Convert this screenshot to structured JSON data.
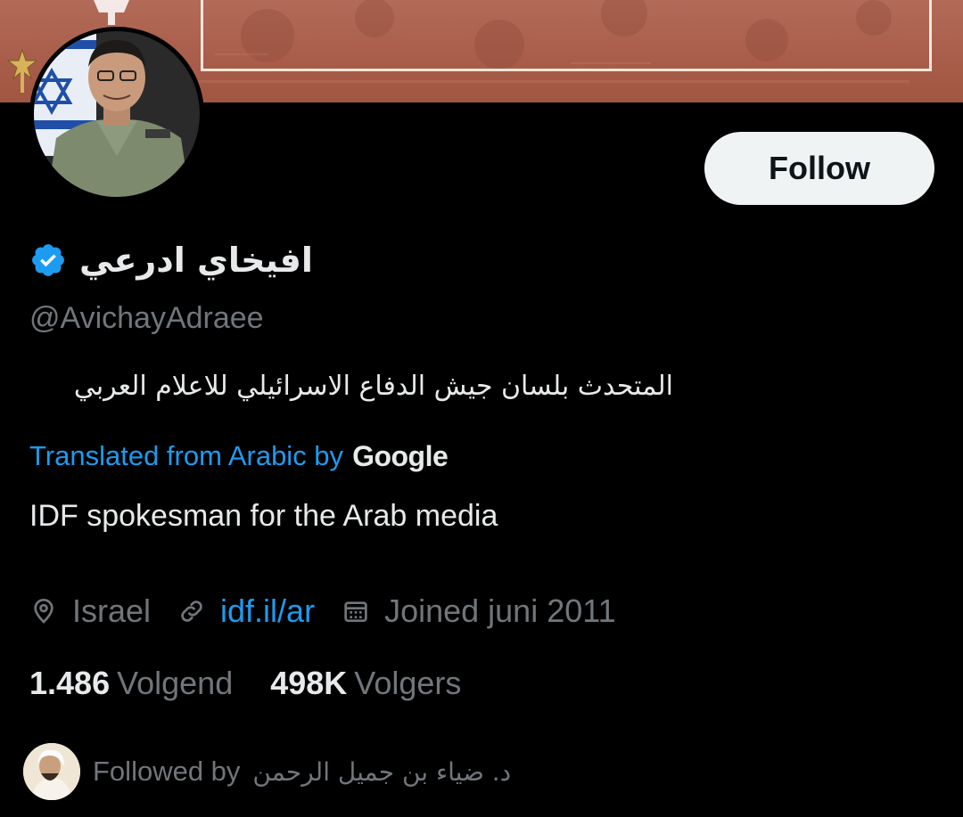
{
  "profile": {
    "display_name": "افيخاي ادرعي",
    "handle": "@AvichayAdraee",
    "bio_original": "المتحدث بلسان جيش الدفاع الاسرائيلي للاعلام العربي",
    "translated_label": "Translated from Arabic by",
    "translator_brand": "Google",
    "bio_translated": "IDF spokesman for the Arab media",
    "location": "Israel",
    "website": "idf.il/ar",
    "joined": "Joined juni 2011",
    "verified": true
  },
  "actions": {
    "follow_label": "Follow"
  },
  "stats": {
    "following_count": "1.486",
    "following_label": "Volgend",
    "followers_count": "498K",
    "followers_label": "Volgers"
  },
  "followed_by": {
    "label": "Followed by",
    "name": "د. ضياء بن جميل الرحمن"
  },
  "icons": {
    "verified": "verified-badge-icon",
    "location": "location-pin-icon",
    "link": "link-icon",
    "calendar": "calendar-icon"
  },
  "colors": {
    "background": "#000000",
    "text_primary": "#e7e9ea",
    "text_secondary": "#71767b",
    "accent_blue": "#1d9bf0",
    "follow_button_bg": "#eff3f4",
    "banner": "#a95e4b"
  }
}
